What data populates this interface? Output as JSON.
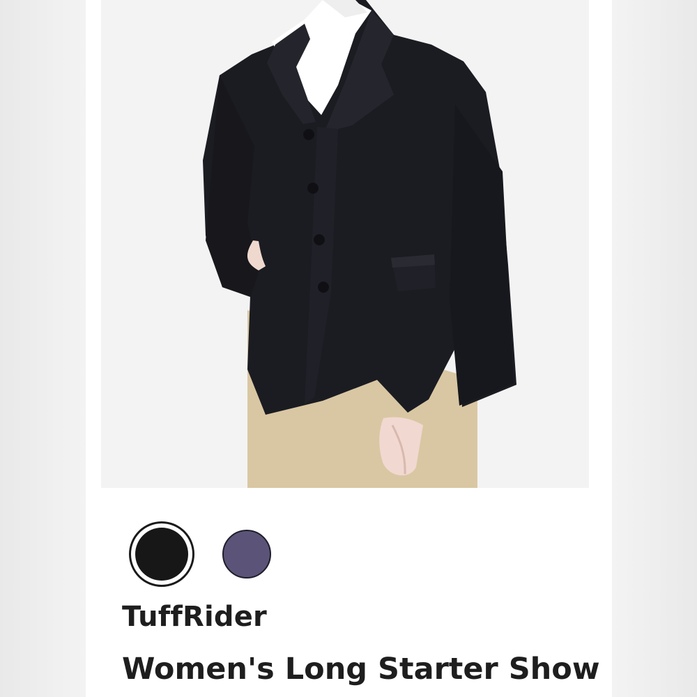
{
  "product": {
    "brand": "TuffRider",
    "title": "Women's Long Starter Show"
  },
  "swatches": [
    {
      "color": "#171717",
      "selected": true
    },
    {
      "color": "#5b5478",
      "selected": false
    }
  ],
  "colors": {
    "jacket": "#1b1c22",
    "breeches": "#d9c7a3",
    "shirt": "#ffffff",
    "text": "#1e1e1e"
  }
}
